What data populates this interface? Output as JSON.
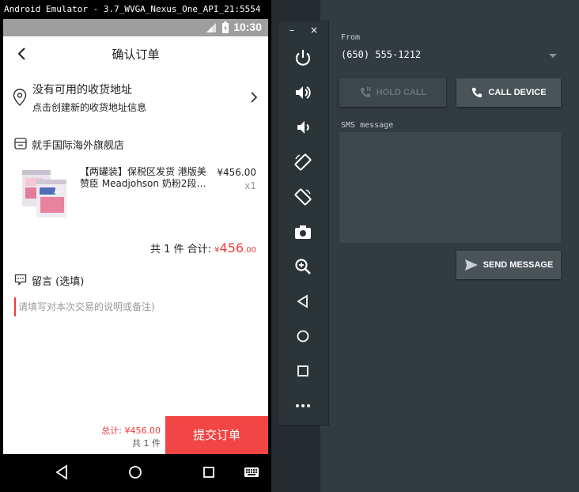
{
  "window": {
    "title": "Android Emulator - 3.7_WVGA_Nexus_One_API_21:5554"
  },
  "statusbar": {
    "time": "10:30"
  },
  "appbar": {
    "title": "确认订单"
  },
  "address": {
    "title": "没有可用的收货地址",
    "subtitle": "点击创建新的收货地址信息"
  },
  "shop": {
    "name": "就手国际海外旗舰店"
  },
  "product": {
    "name": "【两罐装】保税区发货 港版美赞臣 Meadjohson 奶粉2段…",
    "price": "¥456.00",
    "qty": "x1"
  },
  "subtotal": {
    "prefix": "共 1 件 合计: ",
    "currency": "¥",
    "integer": "456",
    "decimal": ".00"
  },
  "memo": {
    "label": "留言 (选填)",
    "placeholder": "请填写对本次交易的说明或备注)"
  },
  "bottom": {
    "total": "总计: ¥456.00",
    "count": "共 1 件",
    "submit": "提交订单"
  },
  "icons": {
    "nav": [
      "back-triangle-icon",
      "home-circle-icon",
      "recents-square-icon",
      "keyboard-icon"
    ],
    "toolbar": [
      "power-icon",
      "volume-up-icon",
      "volume-down-icon",
      "rotate-left-icon",
      "rotate-right-icon",
      "camera-icon",
      "zoom-icon",
      "back-icon",
      "home-icon",
      "overview-icon",
      "more-icon"
    ]
  },
  "toolbar": {
    "minimize": "–",
    "close": "×"
  },
  "panel": {
    "from_label": "From",
    "from_value": "(650) 555-1212",
    "hold_call": "HOLD CALL",
    "call_device": "CALL DEVICE",
    "sms_label": "SMS message",
    "sms_value": "",
    "send_message": "SEND MESSAGE"
  },
  "colors": {
    "accent": "#f24545",
    "panel": "#323b3f",
    "toolbar": "#2b3437",
    "statusbar": "#9e9e9e"
  }
}
